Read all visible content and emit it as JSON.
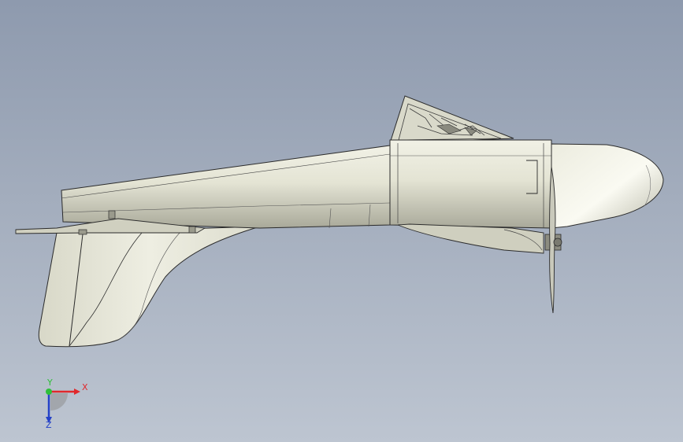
{
  "viewport": {
    "background_top": "#8e9aae",
    "background_bottom": "#bdc5d1"
  },
  "model": {
    "part_fill": "#e6e6d6",
    "part_shade": "#b9b9a8",
    "edge_color": "#2b2b2b"
  },
  "triad": {
    "x_label": "X",
    "y_label": "Y",
    "z_label": "Z",
    "x_color": "#e0282c",
    "y_color": "#2fbf3a",
    "z_color": "#2441c8"
  }
}
